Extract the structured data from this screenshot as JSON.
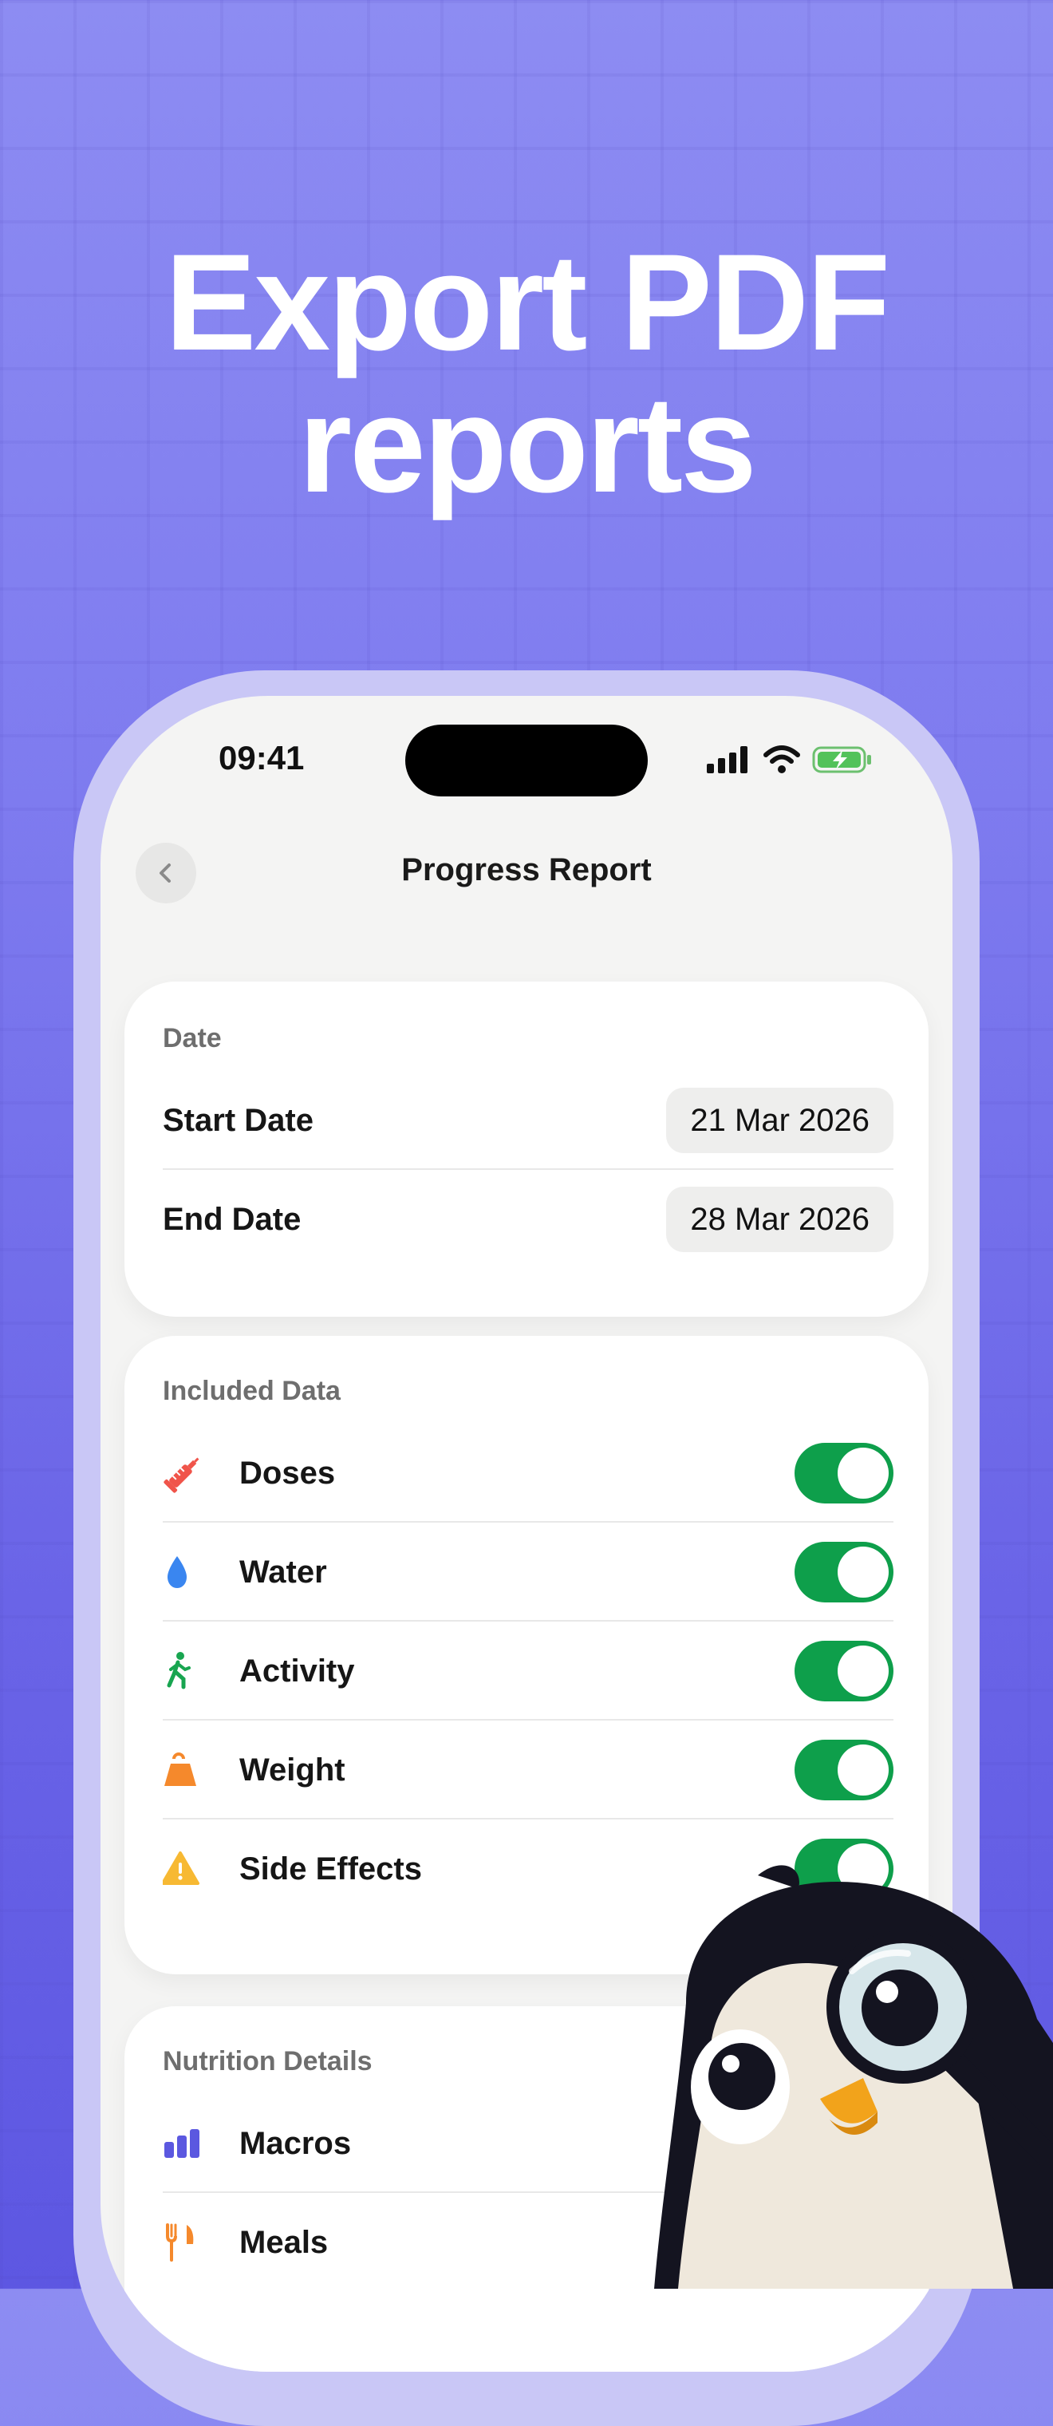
{
  "headline": {
    "line1": "Export PDF",
    "line2": "reports"
  },
  "status_bar": {
    "time": "09:41"
  },
  "nav": {
    "title": "Progress Report"
  },
  "date_card": {
    "header": "Date",
    "rows": [
      {
        "label": "Start Date",
        "value": "21 Mar 2026"
      },
      {
        "label": "End Date",
        "value": "28 Mar 2026"
      }
    ]
  },
  "included_card": {
    "header": "Included Data",
    "rows": [
      {
        "label": "Doses",
        "icon": "syringe-icon",
        "color": "#f0544a",
        "enabled": true
      },
      {
        "label": "Water",
        "icon": "water-drop-icon",
        "color": "#3a86f0",
        "enabled": true
      },
      {
        "label": "Activity",
        "icon": "walking-icon",
        "color": "#18a550",
        "enabled": true
      },
      {
        "label": "Weight",
        "icon": "weight-icon",
        "color": "#f5892c",
        "enabled": true
      },
      {
        "label": "Side Effects",
        "icon": "warning-icon",
        "color": "#f7b933",
        "enabled": true
      }
    ]
  },
  "nutrition_card": {
    "header": "Nutrition Details",
    "rows": [
      {
        "label": "Macros",
        "icon": "bar-chart-icon",
        "color": "#5b58e0"
      },
      {
        "label": "Meals",
        "icon": "fork-knife-icon",
        "color": "#f5892c"
      }
    ]
  },
  "colors": {
    "toggle_on": "#0e9f4b",
    "accent": "#6a64e7"
  }
}
